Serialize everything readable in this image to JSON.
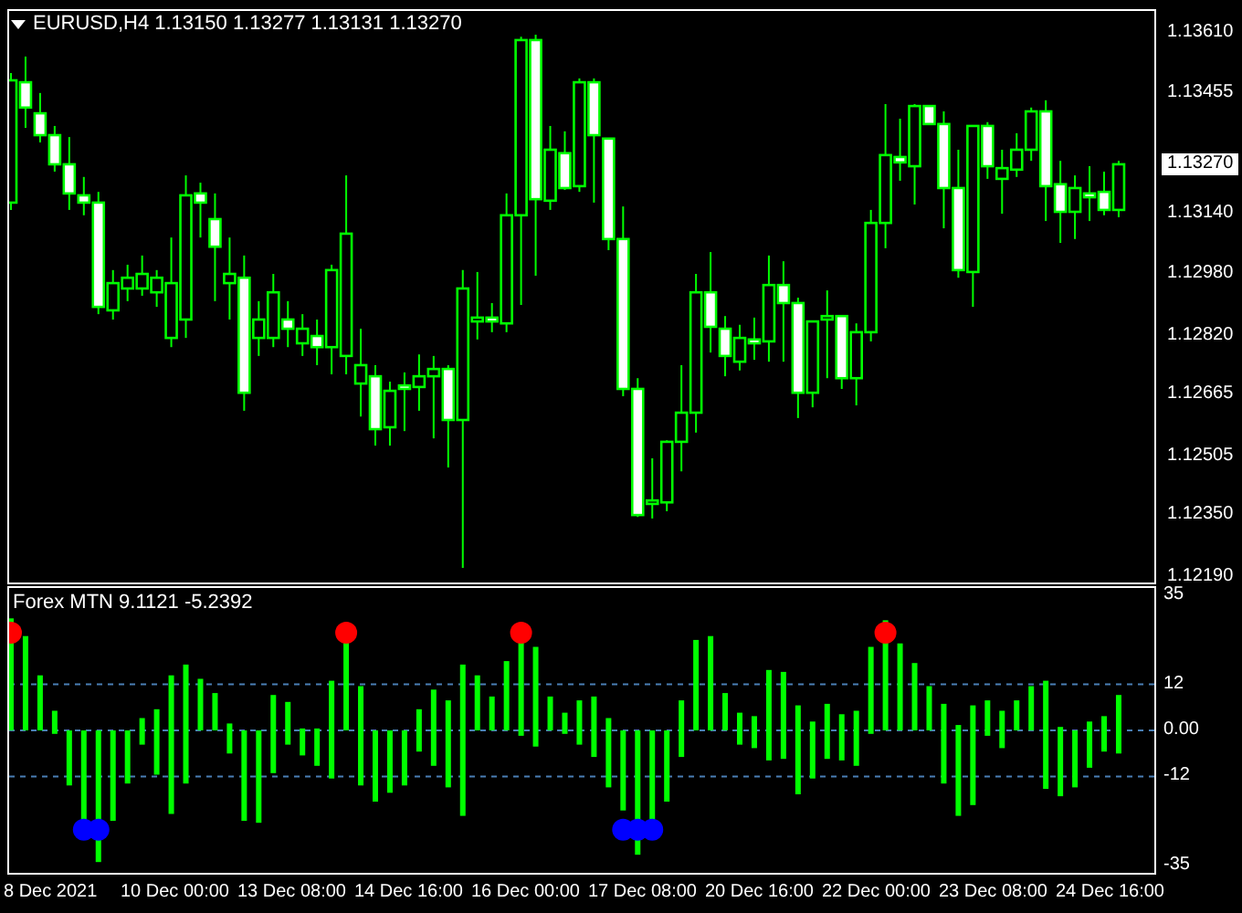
{
  "chart": {
    "title": "EURUSD,H4 1.13150 1.13277 1.13131 1.13270",
    "current_price": "1.13270",
    "chart_data": {
      "type": "candlestick",
      "ylim": [
        1.12176,
        1.13667
      ],
      "yticks": [
        {
          "value": 1.1361,
          "label": "1.13610"
        },
        {
          "value": 1.13455,
          "label": "1.13455"
        },
        {
          "value": 1.1314,
          "label": "1.13140"
        },
        {
          "value": 1.1298,
          "label": "1.12980"
        },
        {
          "value": 1.1282,
          "label": "1.12820"
        },
        {
          "value": 1.12665,
          "label": "1.12665"
        },
        {
          "value": 1.12505,
          "label": "1.12505"
        },
        {
          "value": 1.1235,
          "label": "1.12350"
        },
        {
          "value": 1.1219,
          "label": "1.12190"
        }
      ],
      "categories": [
        null,
        null,
        null,
        null,
        null,
        null,
        null,
        null,
        null,
        null,
        null,
        null,
        null,
        null,
        null,
        null,
        null,
        null,
        null,
        null,
        null,
        null,
        null,
        null,
        null,
        null,
        null,
        null,
        null,
        null,
        null,
        null,
        null,
        null,
        null,
        null,
        null,
        null,
        null,
        null,
        null,
        null,
        null,
        null,
        null,
        null,
        null,
        null,
        null,
        null,
        null,
        null,
        null,
        null,
        null,
        null,
        null,
        null,
        null,
        null,
        null,
        null,
        null,
        null,
        null,
        null,
        null,
        null,
        null,
        null,
        null,
        null,
        null,
        null,
        null,
        null,
        null
      ],
      "ohlc": [
        [
          1.13167,
          1.13505,
          1.13148,
          1.13486
        ],
        [
          1.13481,
          1.13548,
          1.13362,
          1.13415
        ],
        [
          1.134,
          1.13453,
          1.13324,
          1.13343
        ],
        [
          1.13343,
          1.13367,
          1.13248,
          1.13267
        ],
        [
          1.13267,
          1.13338,
          1.13148,
          1.13191
        ],
        [
          1.13186,
          1.13234,
          1.13134,
          1.13167
        ],
        [
          1.13167,
          1.13195,
          1.12876,
          1.12895
        ],
        [
          1.12886,
          1.12991,
          1.12862,
          1.12957
        ],
        [
          1.12943,
          1.13005,
          1.1291,
          1.12971
        ],
        [
          1.12943,
          1.13029,
          1.12924,
          1.12981
        ],
        [
          1.12933,
          1.12991,
          1.12895,
          1.12971
        ],
        [
          1.12814,
          1.13076,
          1.1279,
          1.12957
        ],
        [
          1.12862,
          1.13238,
          1.12814,
          1.13186
        ],
        [
          1.13191,
          1.13219,
          1.13076,
          1.13167
        ],
        [
          1.13124,
          1.13191,
          1.1291,
          1.13052
        ],
        [
          1.12957,
          1.13076,
          1.12862,
          1.12981
        ],
        [
          1.12971,
          1.13029,
          1.12624,
          1.12671
        ],
        [
          1.12814,
          1.1291,
          1.12767,
          1.12862
        ],
        [
          1.12814,
          1.12981,
          1.1279,
          1.12933
        ],
        [
          1.12862,
          1.1291,
          1.1279,
          1.12838
        ],
        [
          1.128,
          1.12876,
          1.12767,
          1.12838
        ],
        [
          1.12819,
          1.12862,
          1.12743,
          1.1279
        ],
        [
          1.1279,
          1.13005,
          1.12719,
          1.12991
        ],
        [
          1.12767,
          1.13238,
          1.12719,
          1.13086
        ],
        [
          1.12695,
          1.12838,
          1.12609,
          1.12743
        ],
        [
          1.12714,
          1.12743,
          1.12533,
          1.12576
        ],
        [
          1.12581,
          1.127,
          1.12533,
          1.12676
        ],
        [
          1.1269,
          1.12724,
          1.12571,
          1.12681
        ],
        [
          1.12686,
          1.12771,
          1.12624,
          1.12714
        ],
        [
          1.12714,
          1.12767,
          1.12552,
          1.12733
        ],
        [
          1.12733,
          1.12743,
          1.12476,
          1.126
        ],
        [
          1.126,
          1.12991,
          1.12214,
          1.12943
        ],
        [
          1.12857,
          1.12986,
          1.1281,
          1.12867
        ],
        [
          1.12867,
          1.12905,
          1.12829,
          1.12857
        ],
        [
          1.12852,
          1.13191,
          1.12829,
          1.13134
        ],
        [
          1.13134,
          1.136,
          1.129,
          1.13591
        ],
        [
          1.13591,
          1.13605,
          1.12976,
          1.13176
        ],
        [
          1.13172,
          1.13367,
          1.13148,
          1.13305
        ],
        [
          1.13296,
          1.13353,
          1.132,
          1.13205
        ],
        [
          1.1321,
          1.13491,
          1.13195,
          1.13481
        ],
        [
          1.13481,
          1.13491,
          1.13167,
          1.13343
        ],
        [
          1.13334,
          1.13334,
          1.13043,
          1.13072
        ],
        [
          1.13072,
          1.13157,
          1.12662,
          1.12681
        ],
        [
          1.12681,
          1.12709,
          1.12347,
          1.12352
        ],
        [
          1.12381,
          1.125,
          1.12343,
          1.1239
        ],
        [
          1.12385,
          1.12547,
          1.12362,
          1.12543
        ],
        [
          1.12543,
          1.12743,
          1.12466,
          1.12619
        ],
        [
          1.12619,
          1.12981,
          1.12567,
          1.12933
        ],
        [
          1.12933,
          1.13038,
          1.12776,
          1.12843
        ],
        [
          1.12838,
          1.12871,
          1.12714,
          1.12767
        ],
        [
          1.12752,
          1.12848,
          1.12729,
          1.12814
        ],
        [
          1.1281,
          1.12867,
          1.12757,
          1.128
        ],
        [
          1.12805,
          1.13029,
          1.12752,
          1.12952
        ],
        [
          1.12952,
          1.13014,
          1.12752,
          1.12905
        ],
        [
          1.12905,
          1.12919,
          1.12605,
          1.12671
        ],
        [
          1.12671,
          1.12857,
          1.12633,
          1.12857
        ],
        [
          1.12862,
          1.12938,
          1.12709,
          1.12871
        ],
        [
          1.12871,
          1.12871,
          1.12681,
          1.12709
        ],
        [
          1.12709,
          1.12852,
          1.12638,
          1.12829
        ],
        [
          1.12829,
          1.13148,
          1.12805,
          1.13114
        ],
        [
          1.13114,
          1.13424,
          1.13048,
          1.13291
        ],
        [
          1.13286,
          1.13386,
          1.13224,
          1.13272
        ],
        [
          1.13262,
          1.13424,
          1.13162,
          1.13419
        ],
        [
          1.13419,
          1.13419,
          1.13372,
          1.13372
        ],
        [
          1.13372,
          1.13405,
          1.131,
          1.13205
        ],
        [
          1.13205,
          1.13305,
          1.12971,
          1.12991
        ],
        [
          1.12986,
          1.13367,
          1.12895,
          1.13367
        ],
        [
          1.13367,
          1.13377,
          1.13229,
          1.13262
        ],
        [
          1.13229,
          1.13305,
          1.13138,
          1.13257
        ],
        [
          1.13253,
          1.13348,
          1.13234,
          1.13305
        ],
        [
          1.13305,
          1.13415,
          1.13276,
          1.13405
        ],
        [
          1.13405,
          1.13434,
          1.13119,
          1.1321
        ],
        [
          1.13215,
          1.13276,
          1.13062,
          1.13143
        ],
        [
          1.13143,
          1.13238,
          1.13072,
          1.13205
        ],
        [
          1.13191,
          1.13262,
          1.13119,
          1.13181
        ],
        [
          1.13195,
          1.13248,
          1.13134,
          1.13148
        ],
        [
          1.13148,
          1.13276,
          1.13129,
          1.13267
        ]
      ]
    }
  },
  "indicator": {
    "title": "Forex MTN 9.1121 -5.2392",
    "chart_data": {
      "type": "bar",
      "ylim": [
        -37,
        37
      ],
      "grid": true,
      "yticks": [
        35,
        12,
        {
          "value": 0,
          "label": "0.00"
        },
        -12,
        -35
      ],
      "categories": [
        null,
        null,
        null,
        null,
        null,
        null,
        null,
        null,
        null,
        null,
        null,
        null,
        null,
        null,
        null,
        null,
        null,
        null,
        null,
        null,
        null,
        null,
        null,
        null,
        null,
        null,
        null,
        null,
        null,
        null,
        null,
        null,
        null,
        null,
        null,
        null,
        null,
        null,
        null,
        null,
        null,
        null,
        null,
        null,
        null,
        null,
        null,
        null,
        null,
        null,
        null,
        null,
        null,
        null,
        null,
        null,
        null,
        null,
        null,
        null,
        null,
        null,
        null,
        null,
        null,
        null,
        null,
        null,
        null,
        null,
        null,
        null,
        null,
        null,
        null,
        null,
        null
      ],
      "series": [
        {
          "color": "#00ff00",
          "values": [
            29.1,
            24.5,
            14.3,
            5.1,
            0,
            0,
            0,
            0,
            0,
            3.2,
            5.5,
            14.3,
            17.1,
            13.4,
            9.7,
            1.8,
            0,
            0,
            9.2,
            7.4,
            0.5,
            0.5,
            12.9,
            23.1,
            11.5,
            0,
            0,
            0,
            5.5,
            10.6,
            7.8,
            17.1,
            14.3,
            8.8,
            18.0,
            23.1,
            21.7,
            8.8,
            4.6,
            7.8,
            8.8,
            3.2,
            0,
            0,
            0,
            0,
            7.8,
            23.5,
            24.5,
            9.7,
            4.6,
            3.7,
            15.7,
            15.2,
            6.5,
            2.3,
            6.9,
            4.2,
            5.1,
            21.7,
            28.6,
            22.6,
            17.5,
            11.5,
            6.9,
            1.4,
            6.5,
            7.8,
            5.1,
            7.8,
            11.5,
            12.9,
            0.9,
            0,
            2.3,
            3.7,
            9.2
          ]
        },
        {
          "color": "#00ff00",
          "values": [
            0,
            0,
            0,
            -0.9,
            -14.3,
            -23.5,
            -34.2,
            -23.5,
            -13.8,
            -3.7,
            -11.5,
            -21.7,
            -13.8,
            0,
            0,
            -6.0,
            -23.5,
            -24.0,
            -11.1,
            -3.7,
            -6.5,
            -9.2,
            -12.5,
            0,
            -14.3,
            -18.5,
            -16.2,
            -14.3,
            -5.5,
            -9.2,
            -14.8,
            -22.2,
            0,
            0,
            0,
            -1.4,
            -4.2,
            0,
            -0.9,
            -3.7,
            -6.9,
            -14.8,
            -20.8,
            -32.3,
            -23.1,
            -18.5,
            -6.9,
            0,
            0,
            0,
            -3.7,
            -4.6,
            -7.8,
            -7.4,
            -16.6,
            -12.5,
            -7.4,
            -7.8,
            -9.2,
            -0.9,
            0,
            0,
            0,
            0,
            -13.8,
            -22.2,
            -19.4,
            -1.4,
            -4.6,
            0,
            0,
            -15.2,
            -17.1,
            -14.8,
            -9.7,
            -5.5,
            -6.0
          ]
        },
        {
          "type": "scatter",
          "color": "#ff0000",
          "values": [
            25.4,
            null,
            null,
            null,
            null,
            null,
            null,
            null,
            null,
            null,
            null,
            null,
            null,
            null,
            null,
            null,
            null,
            null,
            null,
            null,
            null,
            null,
            null,
            25.4,
            null,
            null,
            null,
            null,
            null,
            null,
            null,
            null,
            null,
            null,
            null,
            25.4,
            null,
            null,
            null,
            null,
            null,
            null,
            null,
            null,
            null,
            null,
            null,
            null,
            null,
            null,
            null,
            null,
            null,
            null,
            null,
            null,
            null,
            null,
            null,
            null,
            25.4,
            null,
            null,
            null,
            null,
            null,
            null,
            null,
            null,
            null,
            null,
            null,
            null,
            null,
            null,
            null,
            null
          ]
        },
        {
          "type": "scatter",
          "color": "#0000ff",
          "values": [
            null,
            null,
            null,
            null,
            null,
            -25.8,
            -25.8,
            null,
            null,
            null,
            null,
            null,
            null,
            null,
            null,
            null,
            null,
            null,
            null,
            null,
            null,
            null,
            null,
            null,
            null,
            null,
            null,
            null,
            null,
            null,
            null,
            null,
            null,
            null,
            null,
            null,
            null,
            null,
            null,
            null,
            null,
            null,
            -25.8,
            -25.8,
            -25.8,
            null,
            null,
            null,
            null,
            null,
            null,
            null,
            null,
            null,
            null,
            null,
            null,
            null,
            null,
            null,
            null,
            null,
            null,
            null,
            null,
            null,
            null,
            null,
            null,
            null,
            null,
            null,
            null,
            null,
            null,
            null,
            null
          ]
        }
      ]
    }
  },
  "time_axis": [
    "8 Dec 2021",
    "10 Dec 00:00",
    "13 Dec 08:00",
    "14 Dec 16:00",
    "16 Dec 00:00",
    "17 Dec 08:00",
    "20 Dec 16:00",
    "22 Dec 00:00",
    "23 Dec 08:00",
    "24 Dec 16:00"
  ]
}
